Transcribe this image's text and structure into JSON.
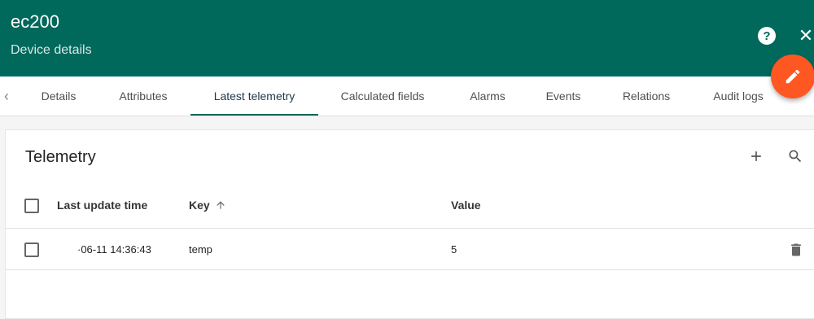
{
  "header": {
    "title": "ec200",
    "subtitle": "Device details",
    "help_label": "?",
    "close_label": "✕"
  },
  "tabs": [
    {
      "label": "Details"
    },
    {
      "label": "Attributes"
    },
    {
      "label": "Latest telemetry"
    },
    {
      "label": "Calculated fields"
    },
    {
      "label": "Alarms"
    },
    {
      "label": "Events"
    },
    {
      "label": "Relations"
    },
    {
      "label": "Audit logs"
    }
  ],
  "active_tab": "Latest telemetry",
  "telemetry": {
    "title": "Telemetry",
    "columns": {
      "time": "Last update time",
      "key": "Key",
      "value": "Value"
    },
    "rows": [
      {
        "time": "·06-11 14:36:43",
        "key": "temp",
        "value": "5"
      }
    ]
  },
  "colors": {
    "primary": "#00695c",
    "accent": "#ff5722"
  }
}
